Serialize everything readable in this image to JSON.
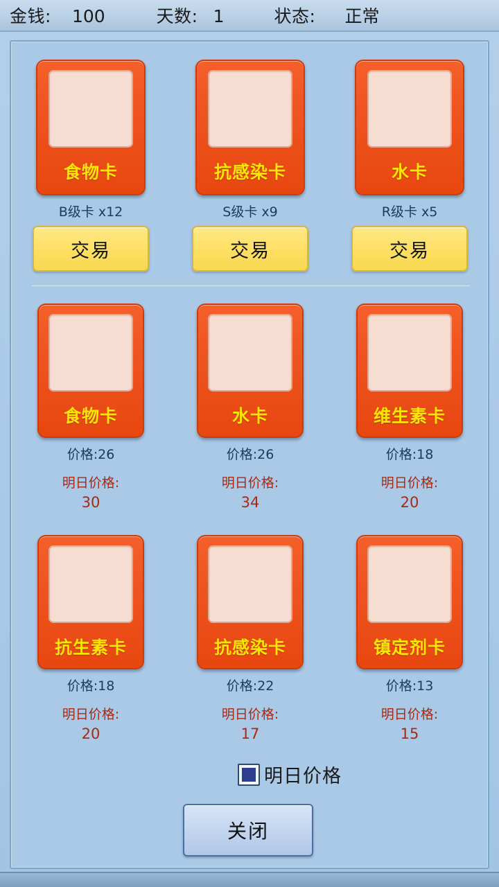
{
  "status_bar": {
    "money_label": "金钱:",
    "money_value": "100",
    "day_label": "天数:",
    "day_value": "1",
    "state_label": "状态:",
    "state_value": "正常"
  },
  "inventory": {
    "items": [
      {
        "name": "食物卡",
        "stock": "B级卡 x12",
        "trade_label": "交易"
      },
      {
        "name": "抗感染卡",
        "stock": "S级卡 x9",
        "trade_label": "交易"
      },
      {
        "name": "水卡",
        "stock": "R级卡 x5",
        "trade_label": "交易"
      }
    ]
  },
  "market": {
    "tomorrow_label": "明日价格:",
    "rows": [
      [
        {
          "name": "食物卡",
          "price": "价格:26",
          "tomorrow_price": "30"
        },
        {
          "name": "水卡",
          "price": "价格:26",
          "tomorrow_price": "34"
        },
        {
          "name": "维生素卡",
          "price": "价格:18",
          "tomorrow_price": "20"
        }
      ],
      [
        {
          "name": "抗生素卡",
          "price": "价格:18",
          "tomorrow_price": "20"
        },
        {
          "name": "抗感染卡",
          "price": "价格:22",
          "tomorrow_price": "17"
        },
        {
          "name": "镇定剂卡",
          "price": "价格:13",
          "tomorrow_price": "15"
        }
      ]
    ]
  },
  "footer": {
    "checkbox_label": "明日价格",
    "checkbox_checked": true,
    "close_label": "关闭"
  },
  "colors": {
    "card_face": "#ef5420",
    "card_text": "#ffe600",
    "trade_button": "#ffe065",
    "price_text": "#1b3a5c",
    "tomorrow_text": "#a82a12",
    "panel_bg": "#a9c9e7"
  }
}
